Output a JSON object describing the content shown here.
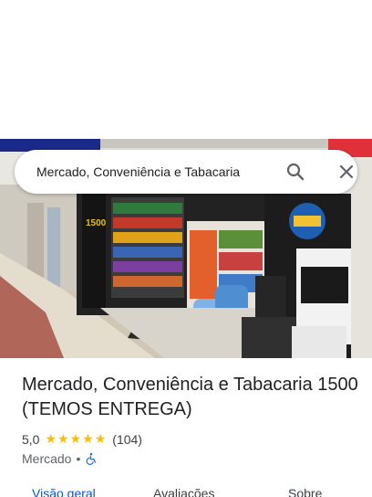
{
  "search": {
    "query": "Mercado, Conveniência e Tabacaria"
  },
  "place": {
    "name": "Mercado, Conveniência e Tabacaria 1500 (TEMOS ENTREGA)",
    "rating": "5,0",
    "stars": 5,
    "review_count": "(104)",
    "category": "Mercado",
    "separator": "•",
    "accessibility_icon": "wheelchair-icon"
  },
  "photo": {
    "description_icon": "storefront-photo",
    "store_sign": "1500"
  },
  "tabs": [
    {
      "label": "Visão geral",
      "active": true
    },
    {
      "label": "Avaliações",
      "active": false
    },
    {
      "label": "Sobre",
      "active": false
    }
  ],
  "colors": {
    "accent": "#0b57d0",
    "star": "#fbbc04",
    "text": "#202124",
    "secondary": "#5f6368"
  }
}
